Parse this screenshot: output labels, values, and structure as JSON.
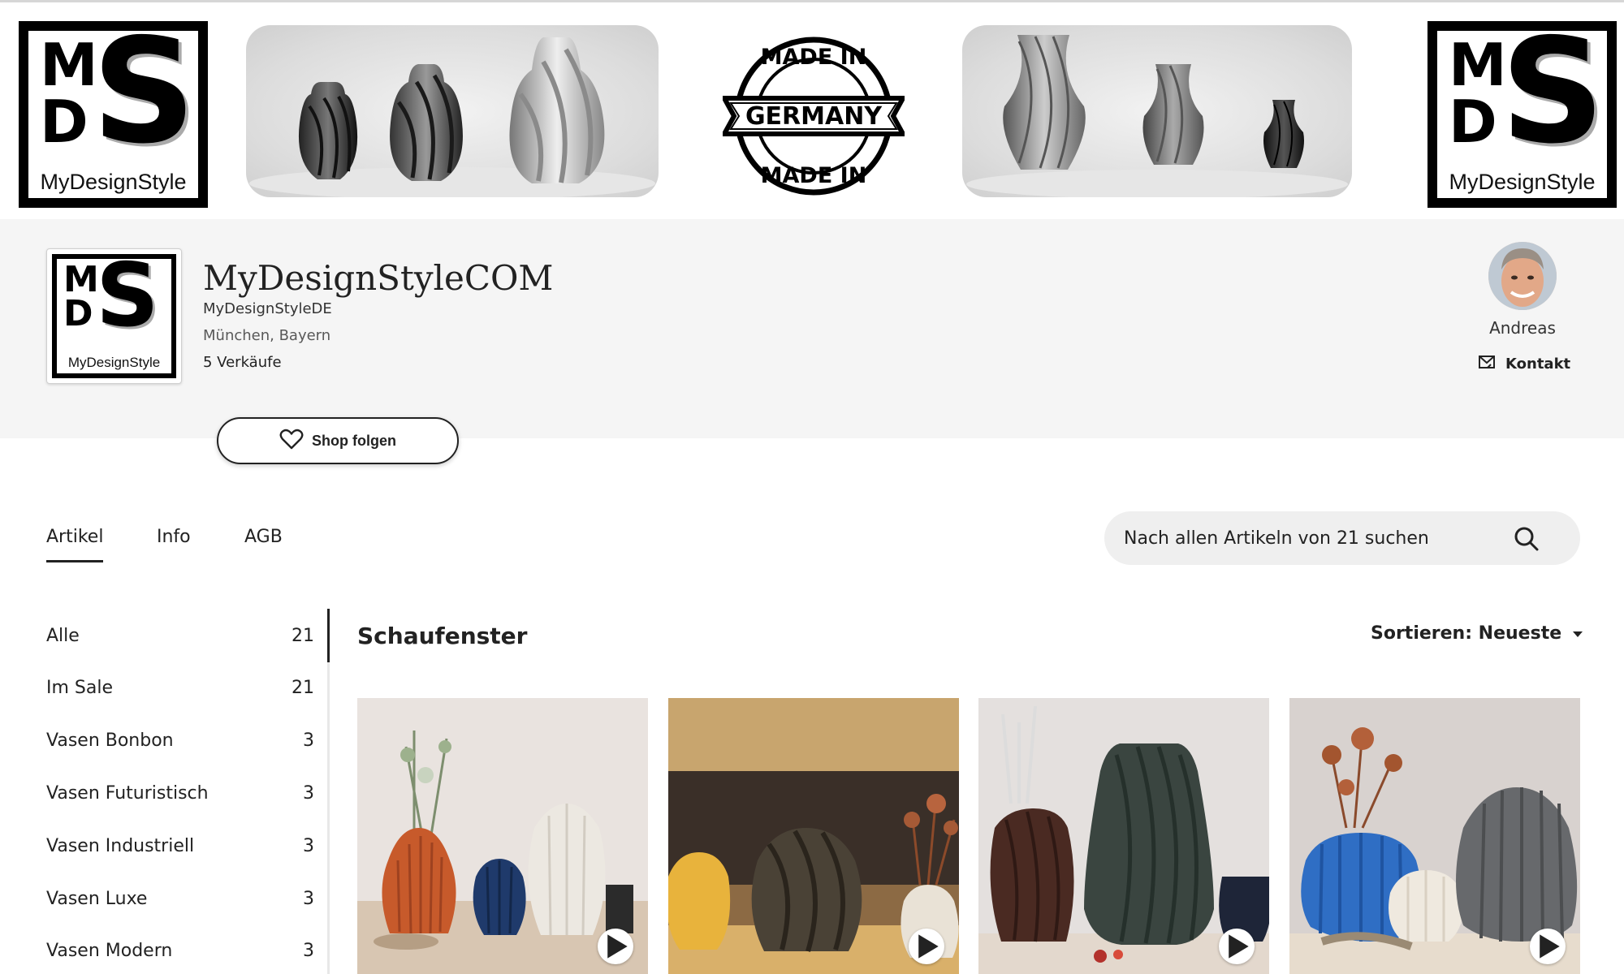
{
  "banner": {
    "logo_caption": "MyDesignStyle",
    "logo_letters": {
      "m": "M",
      "d": "D",
      "s": "S"
    },
    "stamp": {
      "top": "MADE IN",
      "middle": "GERMANY",
      "bottom": "MADE IN"
    }
  },
  "shop": {
    "logo_caption": "MyDesignStyle",
    "name": "MyDesignStyleCOM",
    "subname": "MyDesignStyleDE",
    "location": "München, Bayern",
    "sales": "5 Verkäufe",
    "follow_label": "Shop folgen"
  },
  "owner": {
    "name": "Andreas",
    "contact_label": "Kontakt"
  },
  "tabs": [
    {
      "label": "Artikel",
      "active": true
    },
    {
      "label": "Info",
      "active": false
    },
    {
      "label": "AGB",
      "active": false
    }
  ],
  "search": {
    "placeholder": "Nach allen Artikeln von 21 suchen"
  },
  "sidebar": {
    "items": [
      {
        "label": "Alle",
        "count": "21"
      },
      {
        "label": "Im Sale",
        "count": "21"
      },
      {
        "label": "Vasen Bonbon",
        "count": "3"
      },
      {
        "label": "Vasen Futuristisch",
        "count": "3"
      },
      {
        "label": "Vasen Industriell",
        "count": "3"
      },
      {
        "label": "Vasen Luxe",
        "count": "3"
      },
      {
        "label": "Vasen Modern",
        "count": "3"
      }
    ]
  },
  "main": {
    "section_title": "Schaufenster",
    "sort_label": "Sortieren: Neueste"
  },
  "colors": {
    "accent": "#222222",
    "header_bg": "#f5f5f5",
    "search_bg": "#efefef"
  },
  "icons": [
    "heart-icon",
    "mail-icon",
    "search-icon",
    "caret-down-icon",
    "play-icon"
  ]
}
